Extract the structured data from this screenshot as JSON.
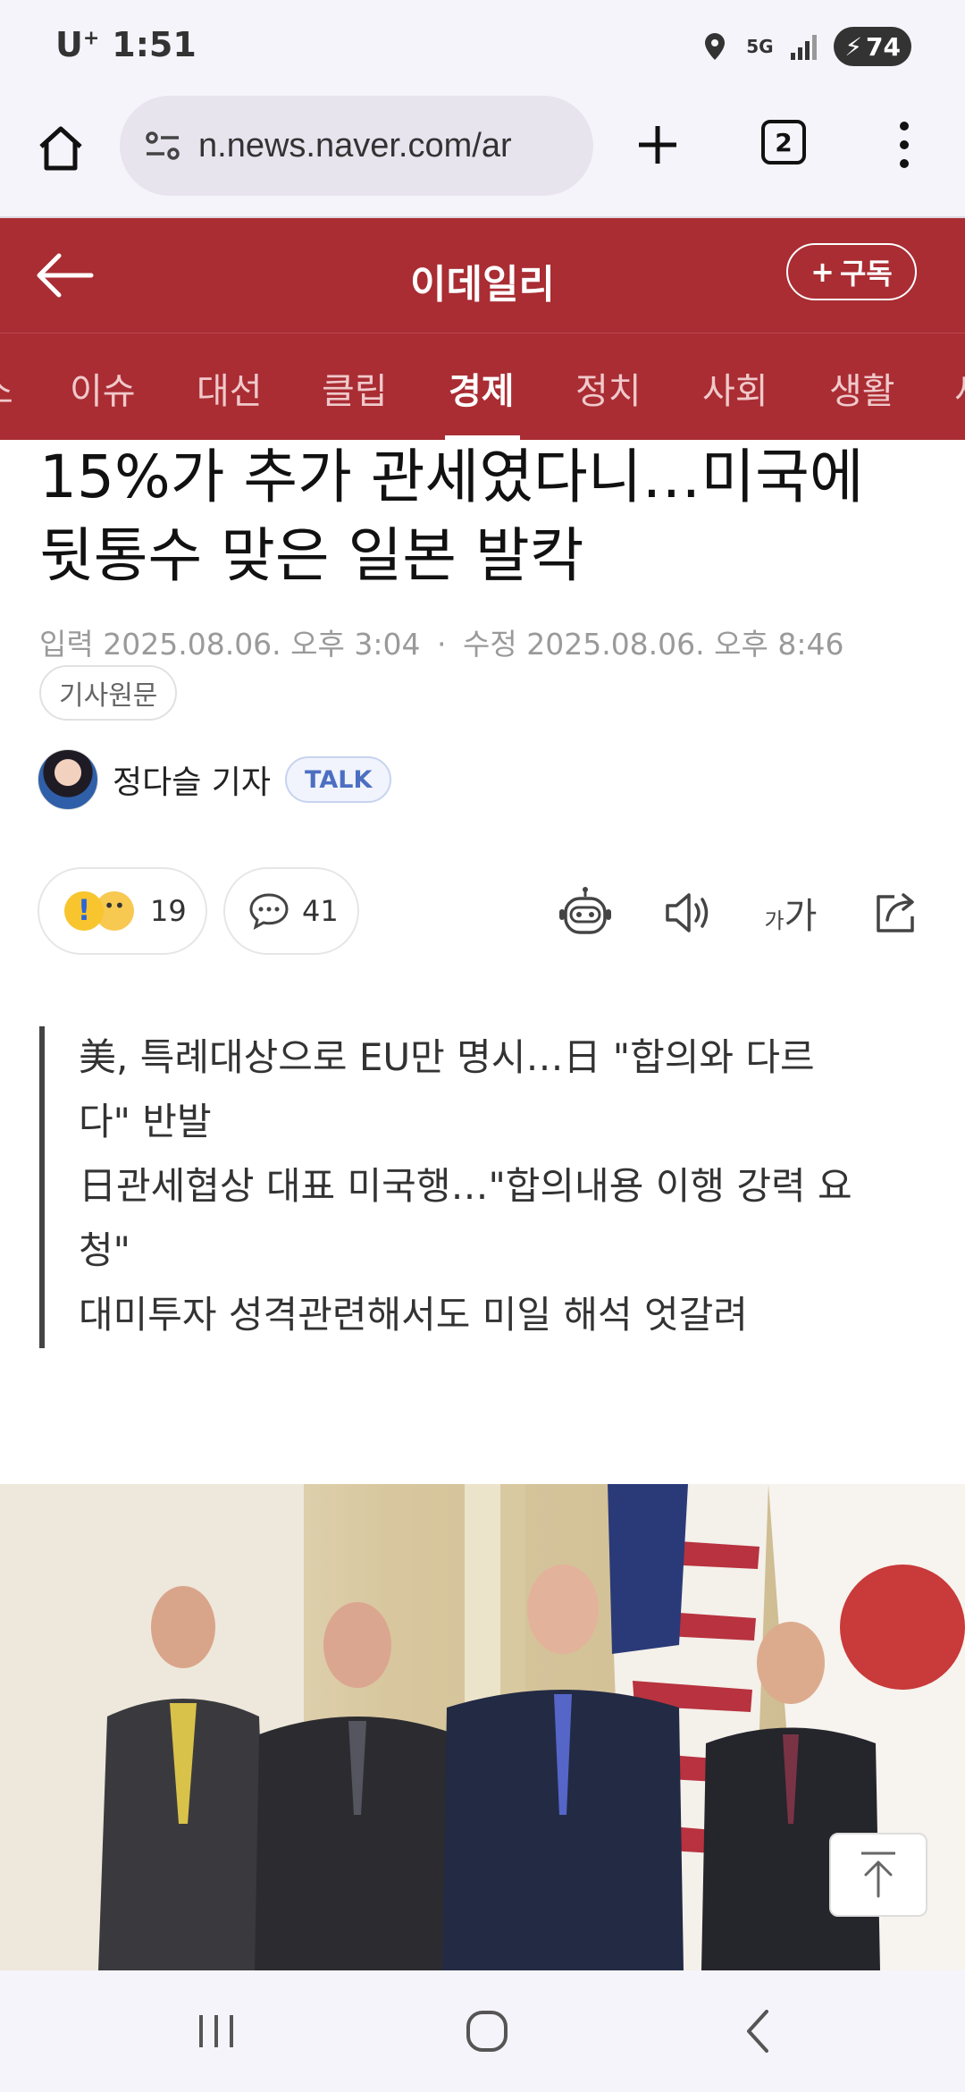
{
  "status_bar": {
    "carrier": "U",
    "carrier_sup": "+",
    "time": "1:51",
    "network": "5G",
    "battery": "74"
  },
  "browser": {
    "url": "n.news.naver.com/ar",
    "tab_count": "2"
  },
  "site": {
    "title": "이데일리",
    "subscribe_label": "구독"
  },
  "categories": [
    {
      "label": "스",
      "active": false
    },
    {
      "label": "이슈",
      "active": false
    },
    {
      "label": "대선",
      "active": false
    },
    {
      "label": "클립",
      "active": false
    },
    {
      "label": "경제",
      "active": true
    },
    {
      "label": "정치",
      "active": false
    },
    {
      "label": "사회",
      "active": false
    },
    {
      "label": "생활",
      "active": false
    },
    {
      "label": "세",
      "active": false
    }
  ],
  "article": {
    "headline_line1": "15%가 추가 관세였다니…미국에",
    "headline_line2": "뒷통수 맞은 일본 발칵",
    "input_label": "입력",
    "input_date": "2025.08.06. 오후 3:04",
    "modified_label": "수정",
    "modified_date": "2025.08.06. 오후 8:46",
    "original_button": "기사원문",
    "reporter": "정다슬 기자",
    "talk_label": "TALK",
    "reaction_count": "19",
    "comment_count": "41",
    "font_small": "가",
    "font_large": "가",
    "summary": [
      "美, 특례대상으로 EU만 명시…日 \"합의와 다르",
      "다\" 반발",
      "日관세협상 대표 미국행…\"합의내용 이행 강력 요",
      "청\"",
      "대미투자 성격관련해서도 미일 해석 엇갈려"
    ]
  },
  "colors": {
    "brand": "#a92d33",
    "status_bg": "#f6f4fb"
  }
}
